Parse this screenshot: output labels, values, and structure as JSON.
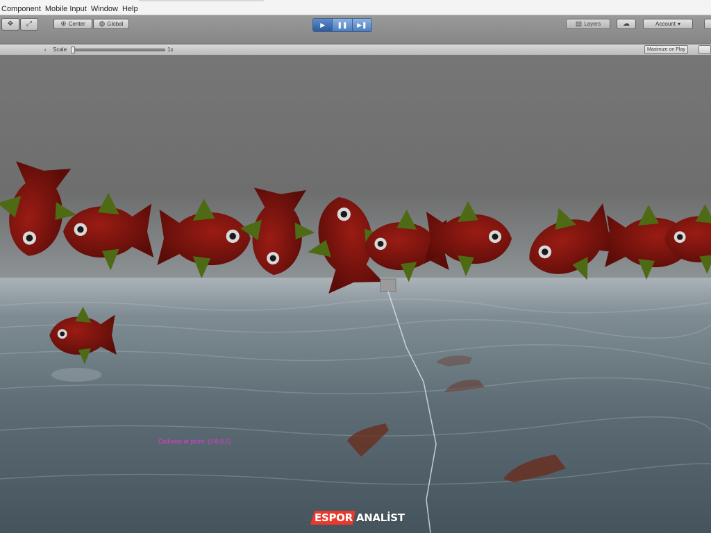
{
  "menubar": {
    "items": [
      "Component",
      "Mobile Input",
      "Window",
      "Help"
    ]
  },
  "toolbar": {
    "pivot_label": "Center",
    "pivot_icon": "center-pivot-icon",
    "space_label": "Global",
    "space_icon": "global-space-icon",
    "play_icon": "play-icon",
    "pause_icon": "pause-icon",
    "step_icon": "step-icon",
    "layers_label": "Layers",
    "account_label": "Account",
    "account_caret": "▾",
    "cloud_icon": "cloud-icon"
  },
  "scene_bar": {
    "scale_label": "Scale",
    "scale_value": "1x",
    "maximize_label": "Maximize on Play"
  },
  "viewport": {
    "debug_text": "Collision at point: (3.8,0.5)",
    "sky_color": "#6b6b6b",
    "water_color": "#4b5a63",
    "fish_body_color": "#7a140f",
    "fish_fin_color": "#4f6a14"
  },
  "watermark": {
    "part_a": "ESPOR",
    "part_b": "ANALİST",
    "accent_color": "#e8392c"
  }
}
